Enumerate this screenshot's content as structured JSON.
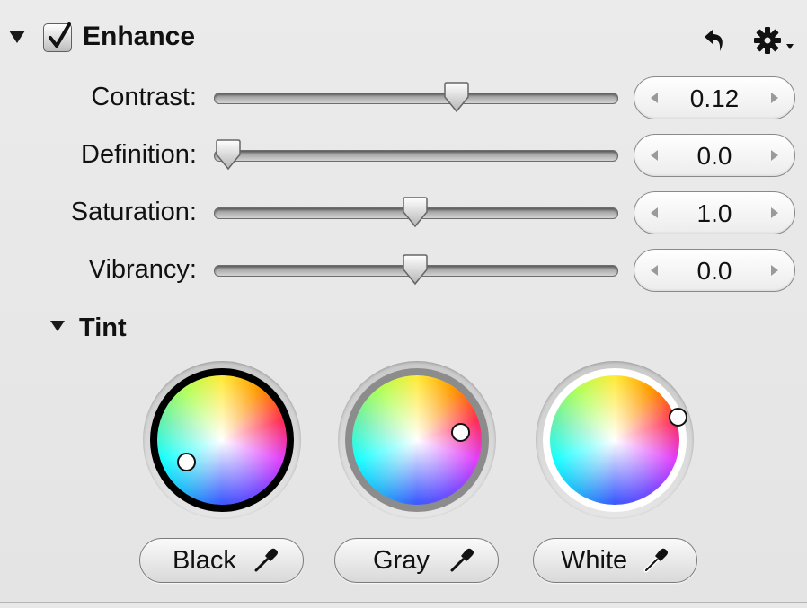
{
  "enhance": {
    "title": "Enhance",
    "checked": true,
    "header_icons": [
      "undo-icon",
      "gear-menu-icon"
    ]
  },
  "sliders": [
    {
      "id": "contrast",
      "label": "Contrast:",
      "value": "0.12",
      "fraction": 0.61
    },
    {
      "id": "definition",
      "label": "Definition:",
      "value": "0.0",
      "fraction": 0.0
    },
    {
      "id": "saturation",
      "label": "Saturation:",
      "value": "1.0",
      "fraction": 0.5
    },
    {
      "id": "vibrancy",
      "label": "Vibrancy:",
      "value": "0.0",
      "fraction": 0.5
    }
  ],
  "tint": {
    "title": "Tint",
    "wheels": [
      {
        "id": "black",
        "button_label": "Black",
        "ring_color": "#000000",
        "picker_icon": "eyedropper-icon"
      },
      {
        "id": "gray",
        "button_label": "Gray",
        "ring_color": "#8c8c8c",
        "picker_icon": "eyedropper-icon"
      },
      {
        "id": "white",
        "button_label": "White",
        "ring_color": "#ffffff",
        "picker_icon": "eyedropper-icon"
      }
    ]
  }
}
